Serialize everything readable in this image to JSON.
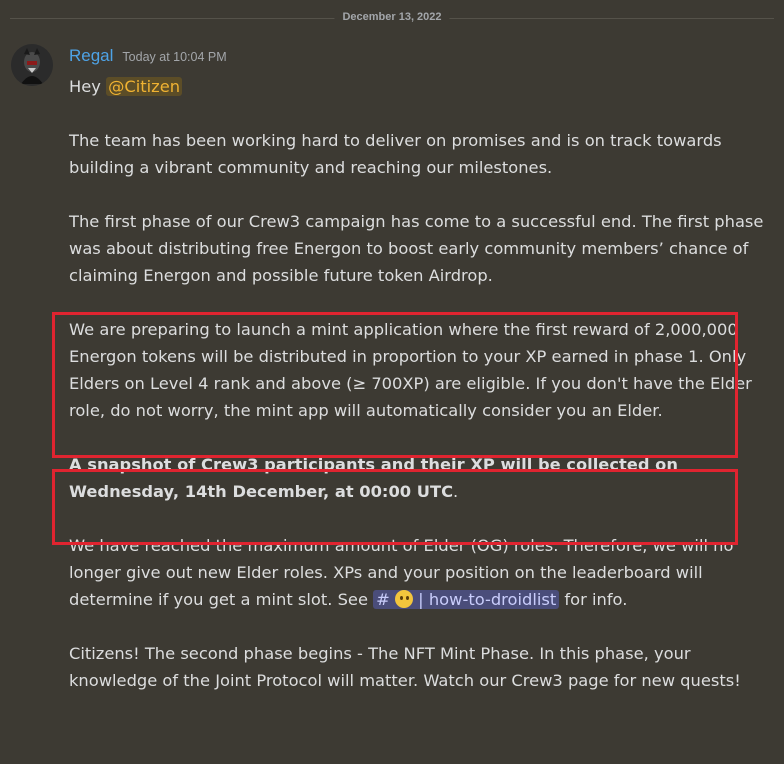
{
  "divider": {
    "date": "December 13, 2022"
  },
  "message": {
    "author": "Regal",
    "timestamp": "Today at 10:04 PM",
    "greeting_prefix": "Hey ",
    "mention": "@Citizen",
    "para1": "The team has been working hard to deliver on promises and is on track towards building a vibrant community and reaching our milestones.",
    "para2": "The first phase of our Crew3 campaign has come to a successful end. The first phase was about distributing free Energon to boost early community members’ chance of claiming Energon and possible future token Airdrop.",
    "para3": "We are preparing to launch a mint application where the first reward of 2,000,000 Energon tokens will be distributed in proportion to your XP earned in phase 1.  Only Elders on Level 4 rank and above (≥ 700XP) are eligible. If you don't have the Elder role, do not worry, the mint app will automatically consider you an Elder.",
    "para4_bold": "A snapshot of Crew3 participants and their XP will be collected on Wednesday, 14th December, at 00:00 UTC",
    "para4_tail": ".",
    "para5_pre": "We have reached the maximum amount of Elder (OG) roles. Therefore, we will no longer give out new Elder roles. XPs and your position on the leaderboard will determine if you get a mint slot. See ",
    "channel_hash": "#",
    "channel_name": "how-to-droidlist",
    "para5_post": "  for info.",
    "para6": "Citizens! The second phase begins - The NFT Mint Phase. In this phase, your knowledge of the Joint Protocol will matter. Watch our Crew3 page for new quests!"
  },
  "colors": {
    "background": "#3d3a33",
    "username": "#4ea3e6",
    "mention_bg": "#5c4d27",
    "mention_text": "#f0b232",
    "highlight_box": "#e02430",
    "channel_bg": "#4a4d7a"
  },
  "icons": {
    "avatar": "avatar-image",
    "channel_emoji": "thinking-face-emoji"
  }
}
